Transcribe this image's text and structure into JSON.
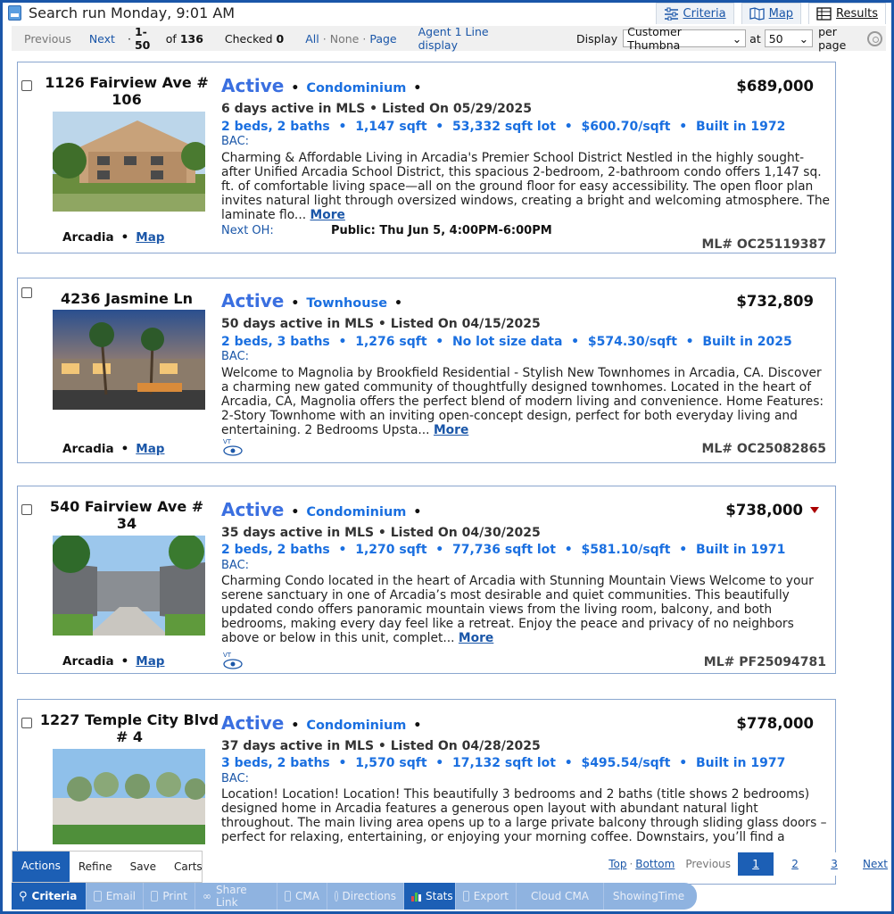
{
  "header": {
    "title": "Search run Monday, 9:01 AM",
    "tabs": [
      {
        "label": "Criteria",
        "icon": "sliders-icon"
      },
      {
        "label": "Map",
        "icon": "map-icon"
      },
      {
        "label": "Results",
        "icon": "table-icon"
      }
    ]
  },
  "toolbar": {
    "previous": "Previous",
    "next": "Next",
    "range": "1-50",
    "of_label": "of",
    "total": "136",
    "checked_label": "Checked",
    "checked_count": "0",
    "all": "All",
    "none": "None",
    "page": "Page",
    "display_mode": "Agent 1 Line display",
    "display_label": "Display",
    "display_value": "Customer Thumbna",
    "at_label": "at",
    "per_page_value": "50",
    "per_page_label": "per page"
  },
  "listings": [
    {
      "address": "1126 Fairview Ave # 106",
      "city": "Arcadia",
      "map_label": "Map",
      "status": "Active",
      "type": "Condominium",
      "price": "$689,000",
      "price_down": false,
      "days": "6 days active in MLS",
      "listed": "Listed On 05/29/2025",
      "beds_baths": "2 beds, 2 baths",
      "sqft": "1,147 sqft",
      "lot": "53,332 sqft lot",
      "ppsf": "$600.70/sqft",
      "built": "Built in 1972",
      "bac": "BAC:",
      "description": "Charming & Affordable Living in Arcadia's Premier School District Nestled in the highly sought-after Unified Arcadia School District, this spacious 2-bedroom, 2-bathroom condo offers 1,147 sq. ft. of comfortable living space—all on the ground floor for easy accessibility. The open floor plan invites natural light through oversized windows, creating a bright and welcoming atmosphere. The laminate flo...",
      "more": "More",
      "open_house_label": "Next OH:",
      "open_house": "Public: Thu Jun 5, 4:00PM-6:00PM",
      "mls": "ML# OC25119387"
    },
    {
      "address": "4236 Jasmine Ln",
      "city": "Arcadia",
      "map_label": "Map",
      "status": "Active",
      "type": "Townhouse",
      "price": "$732,809",
      "price_down": false,
      "days": "50 days active in MLS",
      "listed": "Listed On 04/15/2025",
      "beds_baths": "2 beds, 3 baths",
      "sqft": "1,276 sqft",
      "lot": "No lot size data",
      "ppsf": "$574.30/sqft",
      "built": "Built in 2025",
      "bac": "BAC:",
      "description": "Welcome to Magnolia by Brookfield Residential - Stylish New Townhomes in Arcadia, CA. Discover a charming new gated community of thoughtfully designed townhomes. Located in the heart of Arcadia, CA, Magnolia offers the perfect blend of modern living and convenience. Home Features: 2-Story Townhome with an inviting open-concept design, perfect for both everyday living and entertaining. 2 Bedrooms Upsta...",
      "more": "More",
      "mls": "ML# OC25082865"
    },
    {
      "address": "540 Fairview Ave # 34",
      "city": "Arcadia",
      "map_label": "Map",
      "status": "Active",
      "type": "Condominium",
      "price": "$738,000",
      "price_down": true,
      "days": "35 days active in MLS",
      "listed": "Listed On 04/30/2025",
      "beds_baths": "2 beds, 2 baths",
      "sqft": "1,270 sqft",
      "lot": "77,736 sqft lot",
      "ppsf": "$581.10/sqft",
      "built": "Built in 1971",
      "bac": "BAC:",
      "description": "Charming Condo located in the heart of Arcadia with Stunning Mountain Views Welcome to your serene sanctuary in one of Arcadia’s most desirable and quiet communities. This beautifully updated condo offers panoramic mountain views from the living room, balcony, and both bedrooms, making every day feel like a retreat. Enjoy the peace and privacy of no neighbors above or below in this unit, complet...",
      "more": "More",
      "mls": "ML# PF25094781"
    },
    {
      "address": "1227 Temple City Blvd # 4",
      "status": "Active",
      "type": "Condominium",
      "price": "$778,000",
      "price_down": false,
      "days": "37 days active in MLS",
      "listed": "Listed On 04/28/2025",
      "beds_baths": "3 beds, 2 baths",
      "sqft": "1,570 sqft",
      "lot": "17,132 sqft lot",
      "ppsf": "$495.54/sqft",
      "built": "Built in 1977",
      "bac": "BAC:",
      "description": "Location! Location! Location! This beautifully 3 bedrooms and 2 baths (title shows 2 bedrooms) designed home in Arcadia features a generous open layout with abundant natural light throughout. The main living area opens up to a large private balcony through sliding glass doors – perfect for relaxing, entertaining, or enjoying your morning coffee. Downstairs, you’ll find a charming private"
    }
  ],
  "action_tabs": [
    "Actions",
    "Refine",
    "Save",
    "Carts"
  ],
  "action_buttons": [
    "Criteria",
    "Email",
    "Print",
    "Share Link",
    "CMA",
    "Directions",
    "Stats",
    "Export",
    "Cloud CMA",
    "ShowingTime"
  ],
  "pager": {
    "top": "Top",
    "bottom": "Bottom",
    "previous": "Previous",
    "pages": [
      "1",
      "2",
      "3"
    ],
    "next": "Next"
  }
}
